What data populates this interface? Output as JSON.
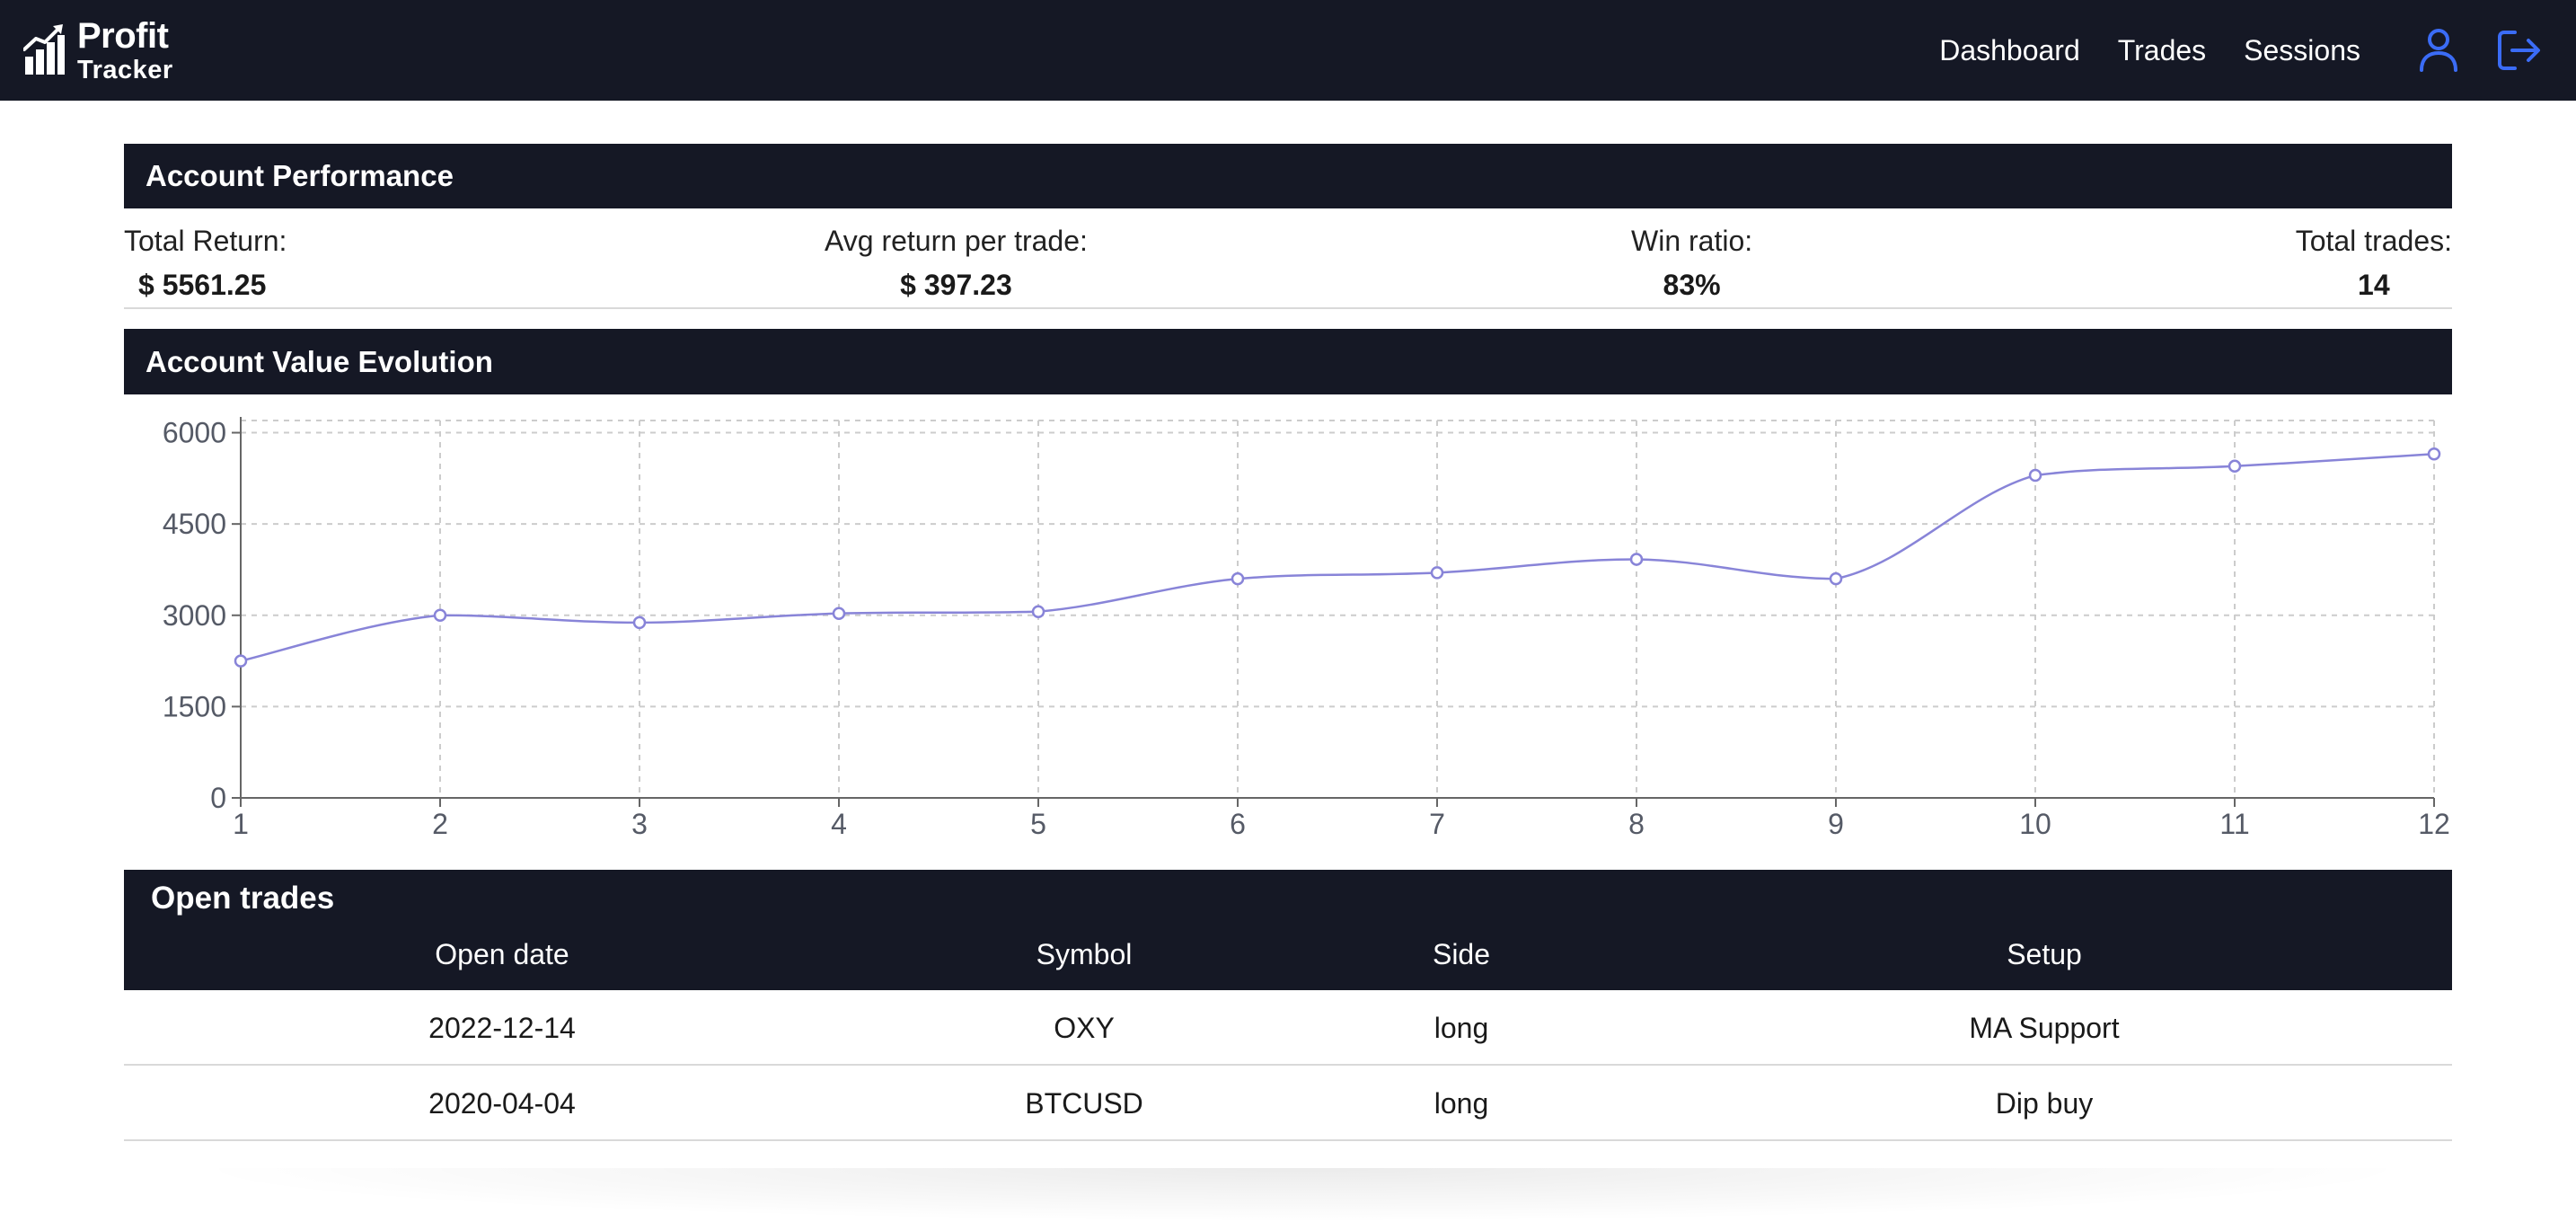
{
  "brand": {
    "name": "Profit",
    "subtitle": "Tracker",
    "logo_icon": "rising-bar-chart-icon"
  },
  "nav": {
    "links": [
      "Dashboard",
      "Trades",
      "Sessions"
    ],
    "profile_icon": "user-icon",
    "logout_icon": "logout-icon"
  },
  "performance": {
    "title": "Account Performance",
    "total_return": {
      "label": "Total Return:",
      "value": "$ 5561.25"
    },
    "avg_return": {
      "label": "Avg return per trade:",
      "value": "$ 397.23"
    },
    "win_ratio": {
      "label": "Win ratio:",
      "value": "83%"
    },
    "total_trades": {
      "label": "Total trades:",
      "value": "14"
    }
  },
  "evolution": {
    "title": "Account Value Evolution"
  },
  "chart_data": {
    "type": "line",
    "title": "Account Value Evolution",
    "xlabel": "",
    "ylabel": "",
    "x": [
      1,
      2,
      3,
      4,
      5,
      6,
      7,
      8,
      9,
      10,
      11,
      12
    ],
    "series": [
      {
        "values": [
          2250,
          3000,
          2880,
          3030,
          3060,
          3600,
          3700,
          3920,
          3600,
          5300,
          5450,
          5650
        ],
        "color": "#8884d8"
      }
    ],
    "yticks": [
      0,
      1500,
      3000,
      4500,
      6000
    ],
    "ylim": [
      0,
      6200
    ],
    "grid": true,
    "curve": "smooth"
  },
  "open_trades": {
    "title": "Open trades",
    "columns": [
      "Open date",
      "Symbol",
      "Side",
      "Setup"
    ],
    "rows": [
      [
        "2022-12-14",
        "OXY",
        "long",
        "MA Support"
      ],
      [
        "2020-04-04",
        "BTCUSD",
        "long",
        "Dip buy"
      ]
    ]
  },
  "colors": {
    "navbar": "#151825",
    "accent": "#3b6cf6",
    "line": "#8884d8"
  }
}
